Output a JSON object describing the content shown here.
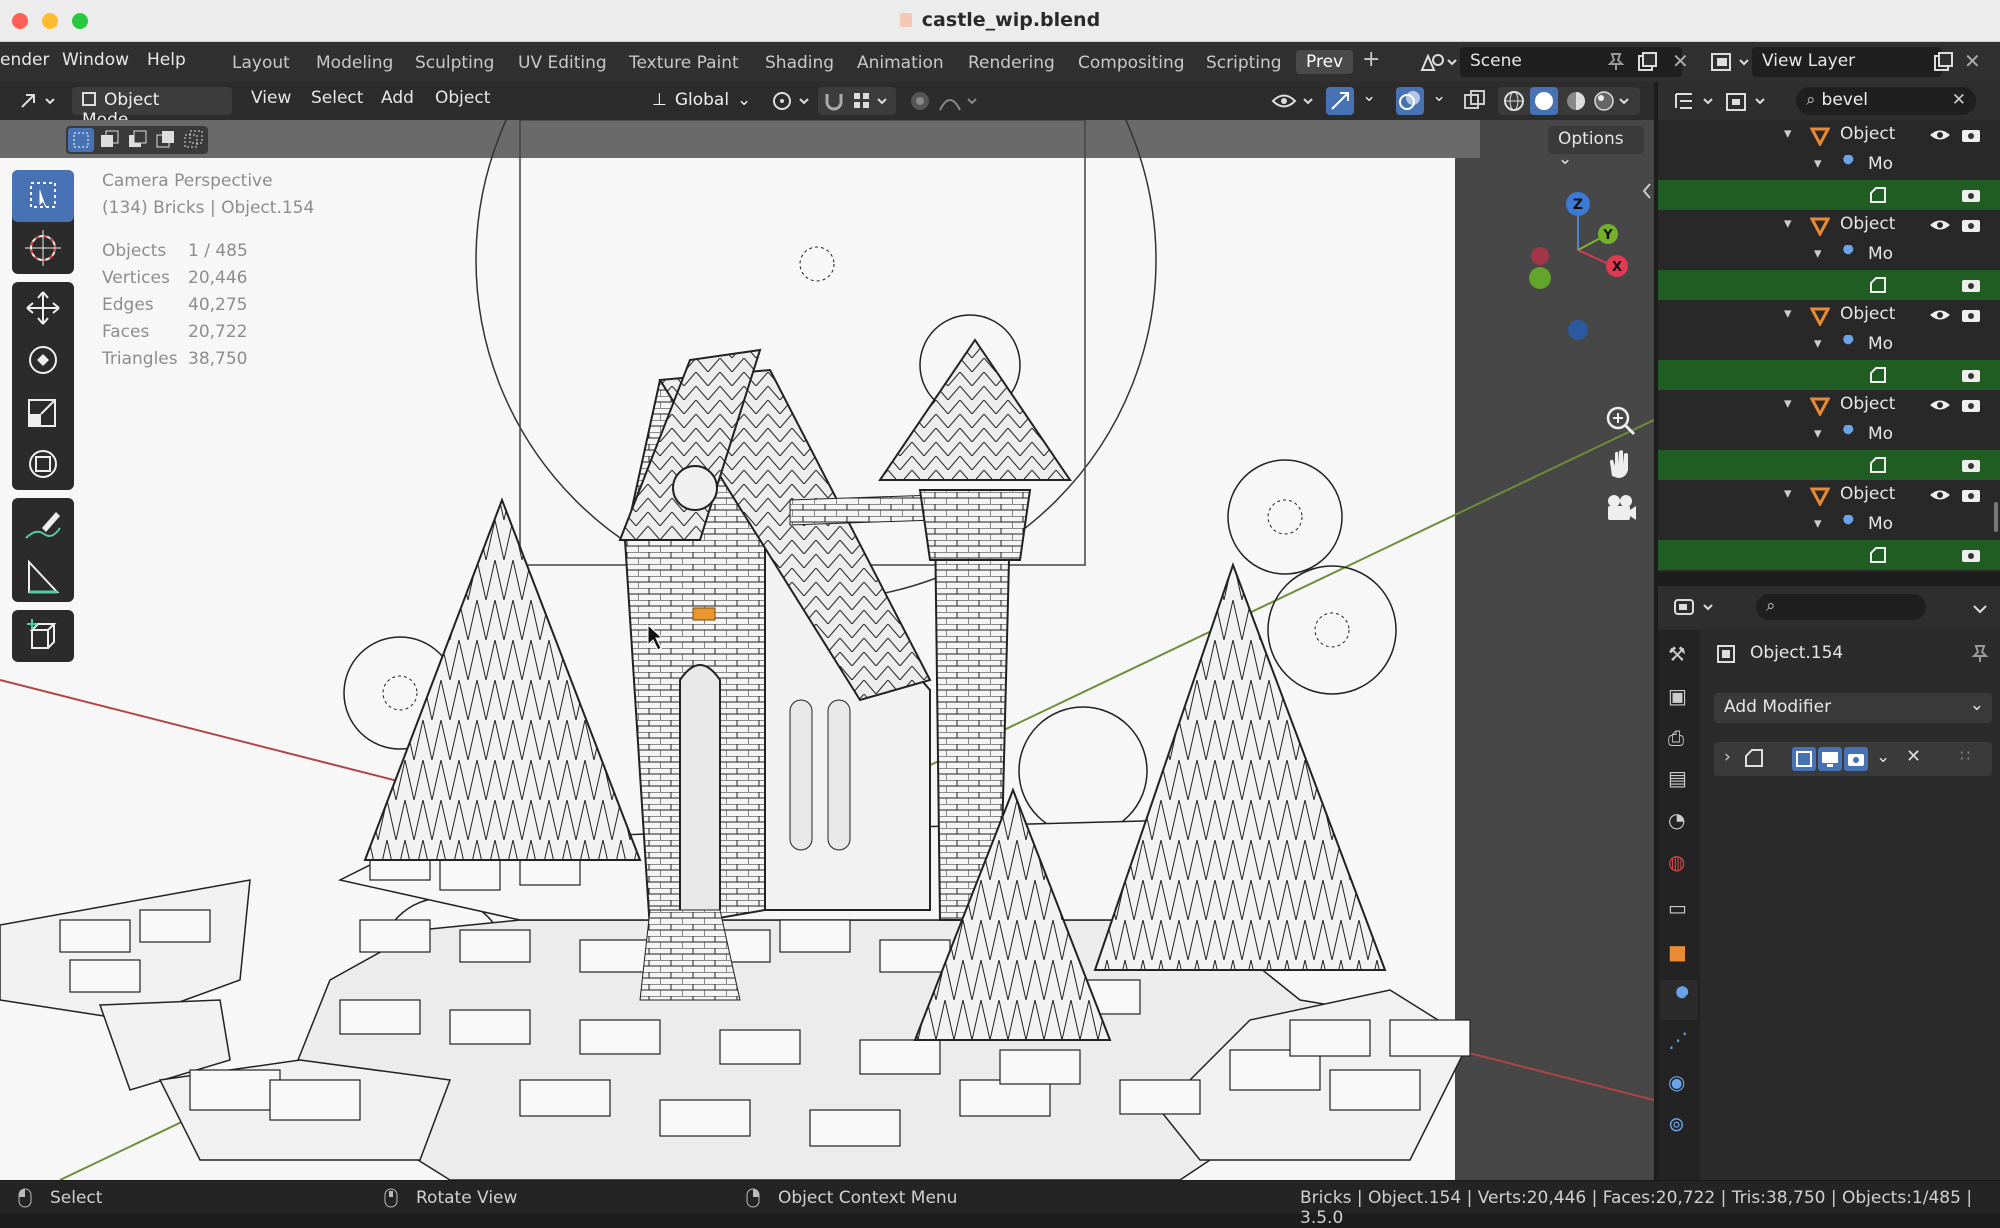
{
  "window": {
    "title": "castle_wip.blend"
  },
  "menubar": {
    "items": [
      "ender",
      "Window",
      "Help"
    ],
    "workspaces": [
      "Layout",
      "Modeling",
      "Sculpting",
      "UV Editing",
      "Texture Paint",
      "Shading",
      "Animation",
      "Rendering",
      "Compositing",
      "Scripting",
      "Prev"
    ],
    "active_workspace": "Prev",
    "scene_name": "Scene",
    "view_layer": "View Layer"
  },
  "viewport_header": {
    "mode": "Object Mode",
    "menus": [
      "View",
      "Select",
      "Add",
      "Object"
    ],
    "transform_orientation": "Global",
    "options_label": "Options"
  },
  "viewport": {
    "camera_label": "Camera Perspective",
    "context_label": "(134) Bricks | Object.154",
    "stats": [
      {
        "label": "Objects",
        "value": "1 / 485"
      },
      {
        "label": "Vertices",
        "value": "20,446"
      },
      {
        "label": "Edges",
        "value": "40,275"
      },
      {
        "label": "Faces",
        "value": "20,722"
      },
      {
        "label": "Triangles",
        "value": "38,750"
      }
    ],
    "gizmo_axes": {
      "z": "Z",
      "y": "Y",
      "x": "X"
    }
  },
  "outliner": {
    "search_value": "bevel",
    "rows": [
      {
        "kind": "object",
        "label": "Object"
      },
      {
        "kind": "modifier",
        "label": "Mo"
      },
      {
        "kind": "mesh",
        "label": ""
      },
      {
        "kind": "object",
        "label": "Object"
      },
      {
        "kind": "modifier",
        "label": "Mo"
      },
      {
        "kind": "mesh",
        "label": ""
      },
      {
        "kind": "object",
        "label": "Object"
      },
      {
        "kind": "modifier",
        "label": "Mo"
      },
      {
        "kind": "mesh",
        "label": ""
      },
      {
        "kind": "object",
        "label": "Object"
      },
      {
        "kind": "modifier",
        "label": "Mo"
      },
      {
        "kind": "mesh",
        "label": ""
      },
      {
        "kind": "object",
        "label": "Object"
      },
      {
        "kind": "modifier",
        "label": "Mo"
      },
      {
        "kind": "mesh",
        "label": ""
      }
    ]
  },
  "properties": {
    "object_name": "Object.154",
    "add_modifier_label": "Add Modifier"
  },
  "statusbar": {
    "select": "Select",
    "rotate": "Rotate View",
    "context_menu": "Object Context Menu",
    "info": "Bricks | Object.154 | Verts:20,446 | Faces:20,722 | Tris:38,750 | Objects:1/485 | 3.5.0"
  },
  "colors": {
    "accent": "#4772b3",
    "outliner_highlight": "#1f5d22",
    "object_orange": "#e98b34",
    "modifier_blue": "#6aa3e8"
  }
}
